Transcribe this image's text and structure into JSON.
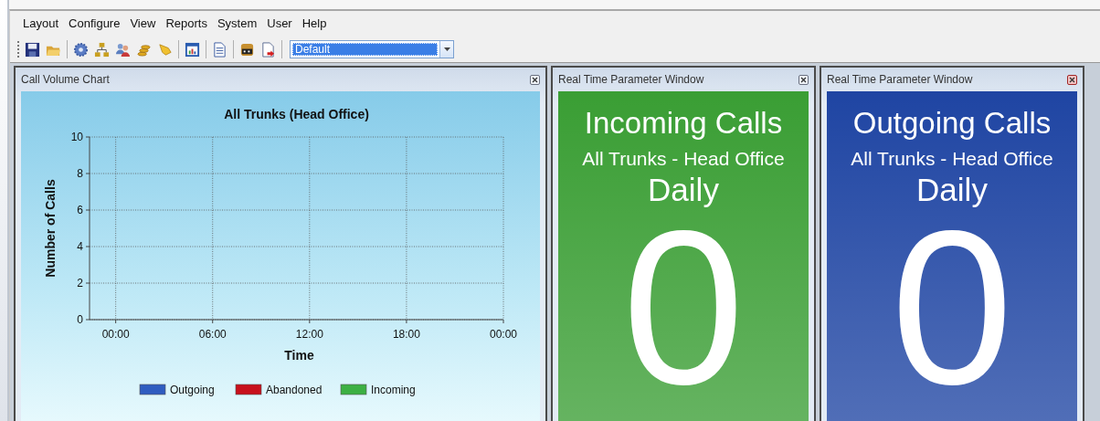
{
  "menu": [
    {
      "label": "Layout"
    },
    {
      "label": "Configure"
    },
    {
      "label": "View"
    },
    {
      "label": "Reports"
    },
    {
      "label": "System"
    },
    {
      "label": "User"
    },
    {
      "label": "Help"
    }
  ],
  "toolbar": {
    "layout_select": {
      "value": "Default"
    }
  },
  "panels": [
    {
      "kind": "chart",
      "title": "Call Volume Chart",
      "active": false,
      "chart_data": {
        "type": "line",
        "title": "All Trunks (Head Office)",
        "xlabel": "Time",
        "ylabel": "Number of Calls",
        "categories": [
          "00:00",
          "06:00",
          "12:00",
          "18:00",
          "00:00"
        ],
        "ylim": [
          0,
          10
        ],
        "yticks": [
          0,
          2,
          4,
          6,
          8,
          10
        ],
        "grid": true,
        "series": [
          {
            "name": "Outgoing",
            "color": "#2f5cc0",
            "values": [
              null,
              null,
              null,
              null,
              null
            ]
          },
          {
            "name": "Abandoned",
            "color": "#c8101c",
            "values": [
              null,
              null,
              null,
              null,
              null
            ]
          },
          {
            "name": "Incoming",
            "color": "#3cb043",
            "values": [
              null,
              null,
              null,
              null,
              null
            ]
          }
        ]
      }
    },
    {
      "kind": "parameter",
      "title": "Real Time Parameter Window",
      "active": false,
      "color": "#3a9e34",
      "heading": "Incoming Calls",
      "subheading": "All Trunks - Head Office",
      "period": "Daily",
      "value": "0"
    },
    {
      "kind": "parameter",
      "title": "Real Time Parameter Window",
      "active": true,
      "color": "#1f45a3",
      "heading": "Outgoing Calls",
      "subheading": "All Trunks - Head Office",
      "period": "Daily",
      "value": "0"
    }
  ]
}
